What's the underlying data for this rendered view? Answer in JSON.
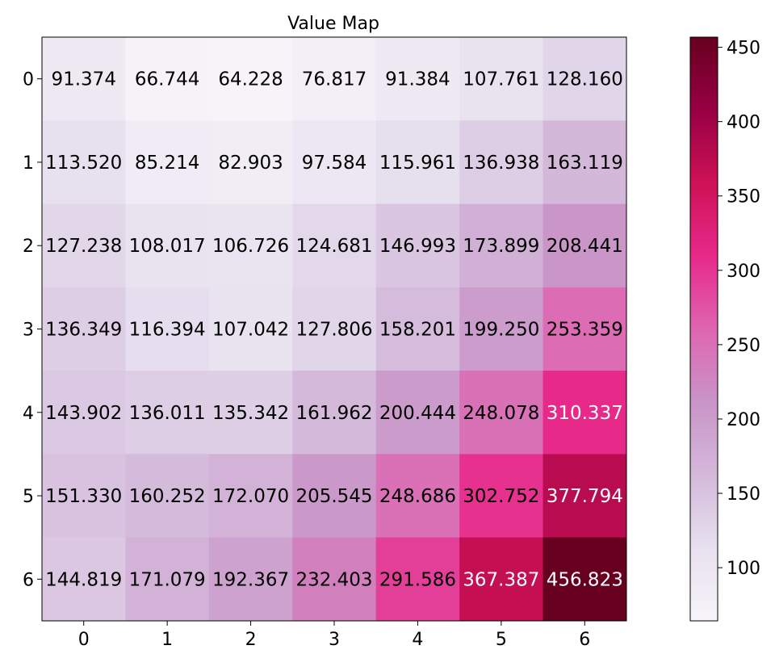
{
  "chart_data": {
    "type": "heatmap",
    "title": "Value Map",
    "xlabel": "",
    "ylabel": "",
    "x_categories": [
      "0",
      "1",
      "2",
      "3",
      "4",
      "5",
      "6"
    ],
    "y_categories": [
      "0",
      "1",
      "2",
      "3",
      "4",
      "5",
      "6"
    ],
    "values": [
      [
        91.374,
        66.744,
        64.228,
        76.817,
        91.384,
        107.761,
        128.16
      ],
      [
        113.52,
        85.214,
        82.903,
        97.584,
        115.961,
        136.938,
        163.119
      ],
      [
        127.238,
        108.017,
        106.726,
        124.681,
        146.993,
        173.899,
        208.441
      ],
      [
        136.349,
        116.394,
        107.042,
        127.806,
        158.201,
        199.25,
        253.359
      ],
      [
        143.902,
        136.011,
        135.342,
        161.962,
        200.444,
        248.078,
        310.337
      ],
      [
        151.33,
        160.252,
        172.07,
        205.545,
        248.686,
        302.752,
        377.794
      ],
      [
        144.819,
        171.079,
        192.367,
        232.403,
        291.586,
        367.387,
        456.823
      ]
    ],
    "cell_labels": [
      [
        "91.374",
        "66.744",
        "64.228",
        "76.817",
        "91.384",
        "107.761",
        "128.160"
      ],
      [
        "113.520",
        "85.214",
        "82.903",
        "97.584",
        "115.961",
        "136.938",
        "163.119"
      ],
      [
        "127.238",
        "108.017",
        "106.726",
        "124.681",
        "146.993",
        "173.899",
        "208.441"
      ],
      [
        "136.349",
        "116.394",
        "107.042",
        "127.806",
        "158.201",
        "199.250",
        "253.359"
      ],
      [
        "143.902",
        "136.011",
        "135.342",
        "161.962",
        "200.444",
        "248.078",
        "310.337"
      ],
      [
        "151.330",
        "160.252",
        "172.070",
        "205.545",
        "248.686",
        "302.752",
        "377.794"
      ],
      [
        "144.819",
        "171.079",
        "192.367",
        "232.403",
        "291.586",
        "367.387",
        "456.823"
      ]
    ],
    "colormap": "PuRd",
    "colormap_stops": [
      "#f7f4f9",
      "#e7e1ef",
      "#d4b9da",
      "#c994c7",
      "#df65b0",
      "#e7298a",
      "#ce1256",
      "#980043",
      "#67001f"
    ],
    "vmin": 64.228,
    "vmax": 456.823,
    "colorbar_ticks": [
      100,
      150,
      200,
      250,
      300,
      350,
      400,
      450
    ],
    "colorbar_tick_labels": [
      "100",
      "150",
      "200",
      "250",
      "300",
      "350",
      "400",
      "450"
    ],
    "grid": false,
    "legend": "colorbar right"
  }
}
